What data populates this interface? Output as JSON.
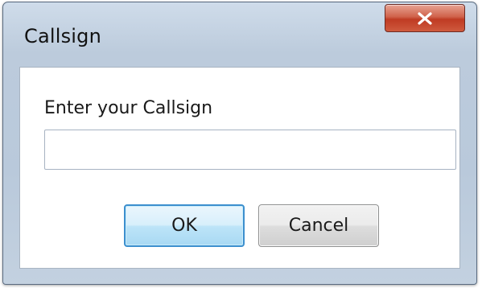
{
  "window": {
    "title": "Callsign",
    "close_icon": "close-icon"
  },
  "form": {
    "prompt": "Enter your Callsign",
    "callsign_value": "",
    "callsign_placeholder": ""
  },
  "buttons": {
    "ok_label": "OK",
    "cancel_label": "Cancel"
  },
  "colors": {
    "close_button": "#c94a30",
    "ok_button_border": "#3c8fce",
    "window_frame": "#bccbdc"
  }
}
